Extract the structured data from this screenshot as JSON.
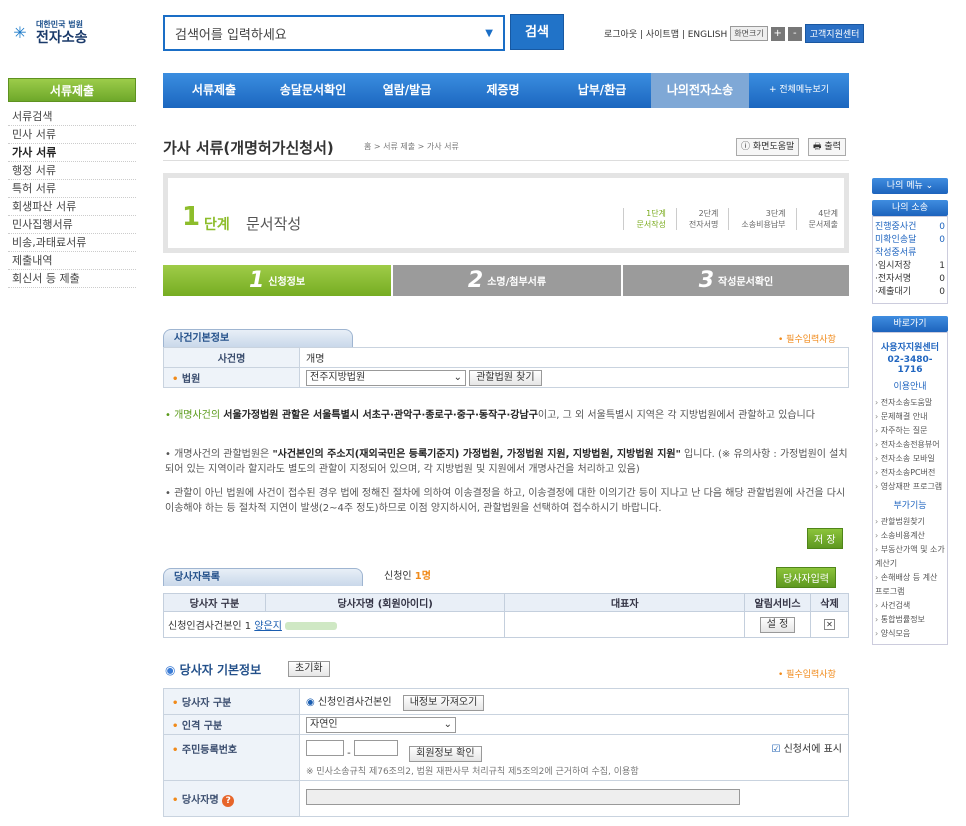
{
  "logo": {
    "top": "대한민국 법원",
    "main": "전자소송"
  },
  "search": {
    "placeholder": "검색어를 입력하세요",
    "button": "검색"
  },
  "util": {
    "links": "로그아웃 | 사이트맵 | ENGLISH",
    "zoom": "화면크기",
    "plus": "+",
    "minus": "-",
    "support": "고객지원센터"
  },
  "nav": {
    "items": [
      "서류제출",
      "송달문서확인",
      "열람/발급",
      "제증명",
      "납부/환급",
      "나의전자소송"
    ],
    "all": "+ 전체메뉴보기"
  },
  "left": {
    "title": "서류제출",
    "items": [
      "서류검색",
      "민사 서류",
      "가사 서류",
      "행정 서류",
      "특허 서류",
      "회생파산 서류",
      "민사집행서류",
      "비송,과태료서류",
      "제출내역",
      "회신서 등 제출"
    ]
  },
  "page": {
    "title": "가사 서류(개명허가신청서)",
    "breadcrumb": "홈 > 서류 제출 > 가사 서류",
    "help": "화면도움말",
    "print": "출력"
  },
  "stepbox": {
    "num": "1",
    "step": "단계",
    "title": "문서작성",
    "steps": [
      [
        "1단계",
        "문서작성"
      ],
      [
        "2단계",
        "전자서명"
      ],
      [
        "3단계",
        "소송비용납부"
      ],
      [
        "4단계",
        "문서제출"
      ]
    ]
  },
  "tabs": [
    {
      "num": "1",
      "label": "신청정보"
    },
    {
      "num": "2",
      "label": "소명/첨부서류"
    },
    {
      "num": "3",
      "label": "작성문서확인"
    }
  ],
  "case": {
    "header": "사건기본정보",
    "required": "• 필수입력사항",
    "name_label": "사건명",
    "name_value": "개명",
    "court_label": "법원",
    "court_value": "전주지방법원",
    "court_find": "관할법원 찾기",
    "note1_a": "• 개명사건의 ",
    "note1_b": "서울가정법원 관할은 서울특별시 서초구·관악구·종로구·중구·동작구·강남구",
    "note1_c": "이고, 그 외 서울특별시 지역은 각 지방법원에서 관할하고 있습니다",
    "note2_a": "• 개명사건의 관할법원은 ",
    "note2_b": "\"사건본인의 주소지(재외국민은 등록기준지) 가정법원, 가정법원 지원, 지방법원, 지방법원 지원\"",
    "note2_c": " 입니다. (※ 유의사항 : 가정법원이 설치되어 있는 지역이라 할지라도 별도의 관할이 지정되어 있으며, 각 지방법원 및 지원에서 개명사건을 처리하고 있음)",
    "note3": "• 관할이 아닌 법원에 사건이 접수된 경우 법에 정해진 절차에 의하여 이송결정을 하고, 이송결정에 대한 이의기간 등이 지나고 난 다음 해당 관할법원에 사건을 다시 이송해야 하는 등 절차적 지연이 발생(2~4주 정도)하므로 이점 양지하시어, 관할법원을 선택하여 접수하시기 바랍니다.",
    "save": "저 장"
  },
  "parties": {
    "header": "당사자목록",
    "count_label": "신청인",
    "count": "1명",
    "add": "당사자입력",
    "cols": [
      "당사자 구분",
      "당사자명 (회원아이디)",
      "대표자",
      "알림서비스",
      "삭제"
    ],
    "row": {
      "type": "신청인겸사건본인 1",
      "name": "양은지",
      "setting": "설 정"
    }
  },
  "basic": {
    "title": "당사자 기본정보",
    "reset": "초기화",
    "required": "• 필수입력사항",
    "type_label": "당사자 구분",
    "type_value": "신청인겸사건본인",
    "import": "내정보 가져오기",
    "person_label": "인격 구분",
    "person_value": "자연인",
    "rrn_label": "주민등록번호",
    "rrn_check": "회원정보 확인",
    "show_label": "신청서에 표시",
    "rrn_note": "※ 민사소송규칙 제76조의2, 법원 재판사무 처리규칙 제5조의2에 근거하여 수집, 이용함",
    "name_label": "당사자명"
  },
  "right": {
    "my_menu": "나의 메뉴",
    "my_case": "나의 소송",
    "rows": [
      [
        "진행중사건",
        "0"
      ],
      [
        "미확인송달",
        "0"
      ],
      [
        "작성중서류",
        ""
      ],
      [
        "·임시저장",
        "1"
      ],
      [
        "·전자서명",
        "0"
      ],
      [
        "·제출대기",
        "0"
      ]
    ],
    "shortcut": "바로가기",
    "center": "사용자지원센터",
    "phone": "02-3480-1716",
    "guide": "이용안내",
    "guide_links": [
      "전자소송도움말",
      "문제해결 안내",
      "자주하는 질문",
      "전자소송전용뷰어",
      "전자소송 모바일",
      "전자소송PC버전",
      "영상재판 프로그램"
    ],
    "extra": "부가기능",
    "extra_links": [
      "관할법원찾기",
      "소송비용계산",
      "부동산가액 및 소가계산기",
      "손해배상 등 계산 프로그램",
      "사건검색",
      "통합법률정보",
      "양식모음"
    ]
  }
}
